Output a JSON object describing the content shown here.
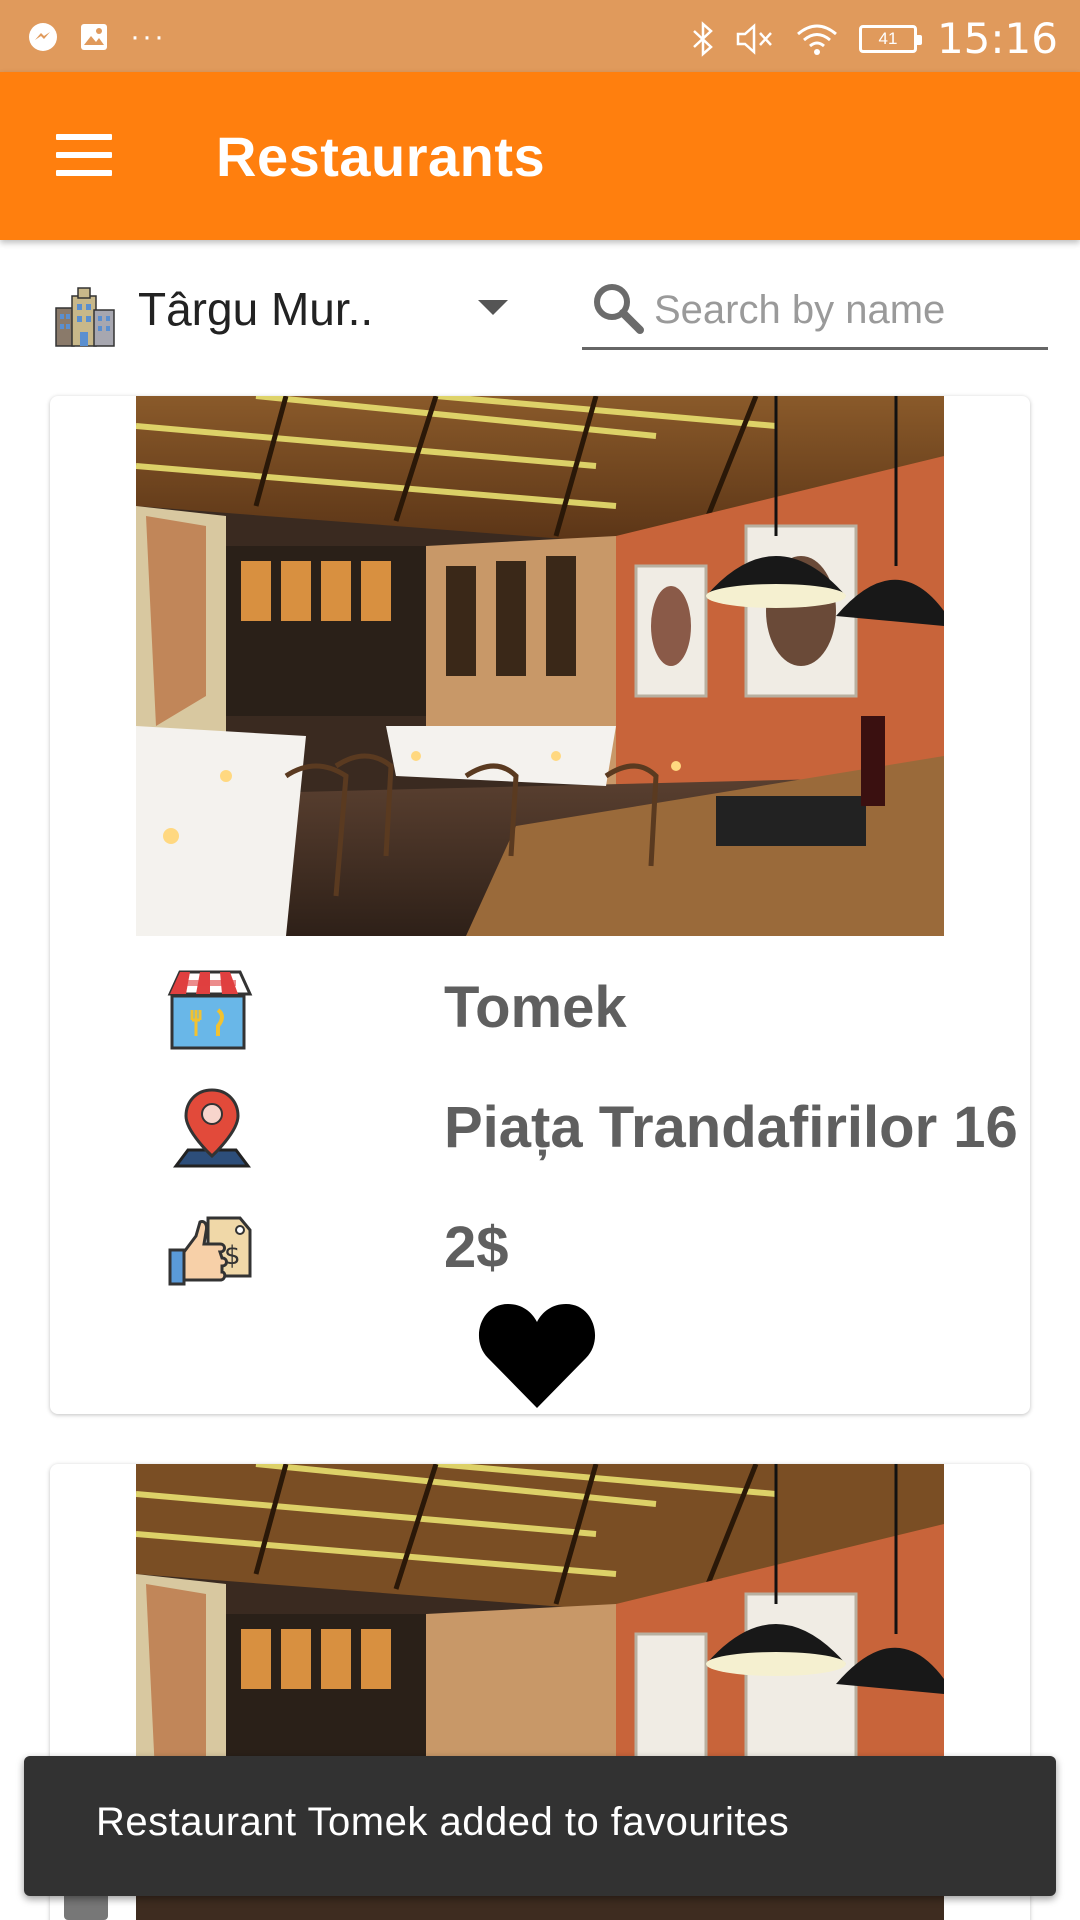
{
  "status_bar": {
    "time": "15:16",
    "battery": "41",
    "left_icons": [
      "messenger-icon",
      "image-icon",
      "more-dots-icon"
    ],
    "right_icons": [
      "bluetooth-icon",
      "mute-icon",
      "wifi-icon",
      "battery-icon"
    ]
  },
  "app_bar": {
    "title": "Restaurants",
    "menu_icon": "hamburger-icon",
    "color": "#FF7F0E"
  },
  "filter": {
    "city": "Târgu Mur..",
    "city_icon": "city-buildings-icon",
    "search_placeholder": "Search by name",
    "search_value": "",
    "search_icon": "search-icon"
  },
  "restaurants": [
    {
      "name": "Tomek",
      "address": "Piața Trandafirilor 16",
      "price": "2$",
      "name_icon": "shop-icon",
      "address_icon": "location-pin-icon",
      "price_icon": "price-tag-thumbs-up-icon",
      "favourite": true,
      "favourite_icon": "heart-icon"
    },
    {
      "name": "",
      "address": "",
      "price": ""
    }
  ],
  "snackbar": {
    "message": "Restaurant Tomek added to favourites"
  },
  "colors": {
    "status_bar": "#E09A5C",
    "accent": "#FF7F0E",
    "snackbar": "#323232",
    "card_text": "#5f5f5f"
  }
}
